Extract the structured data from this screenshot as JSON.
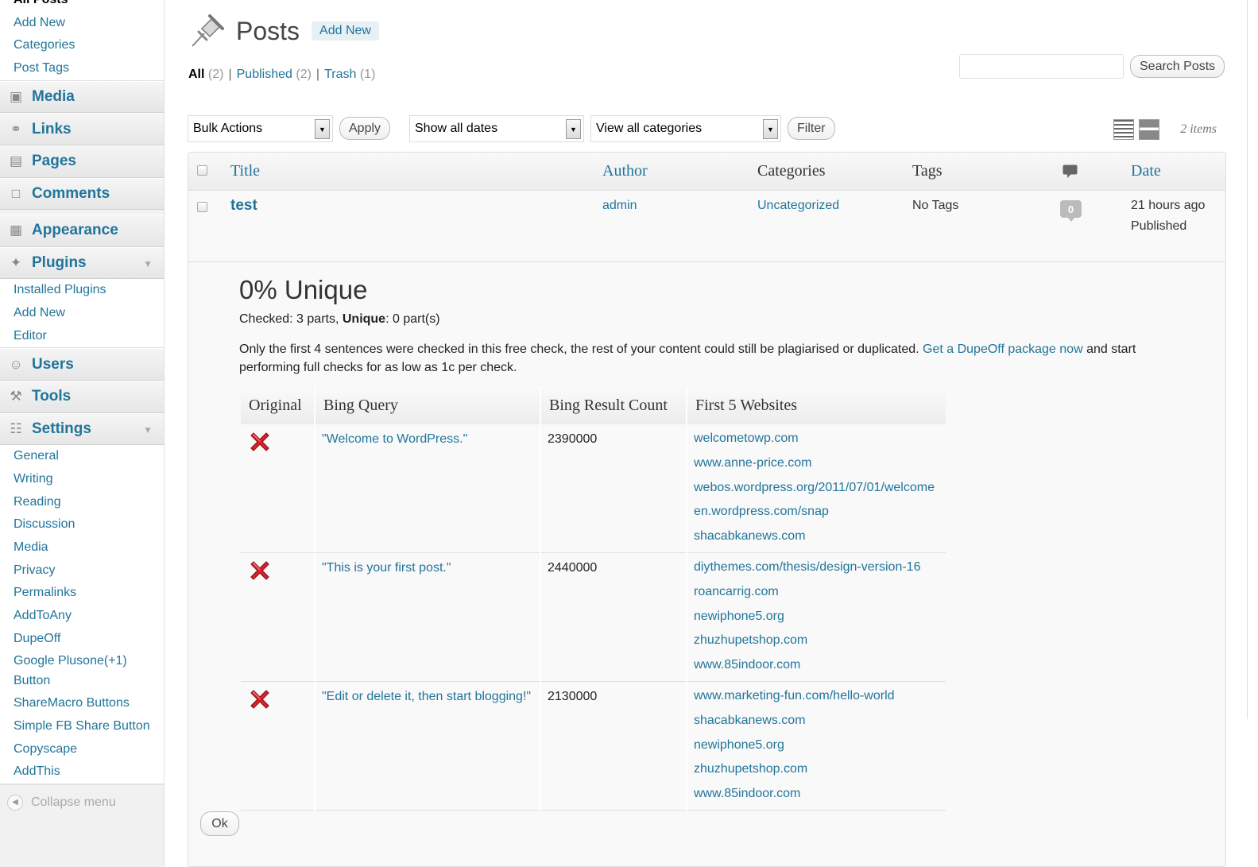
{
  "sidebar": {
    "posts_sub": [
      {
        "label": "All Posts",
        "current": true
      },
      {
        "label": "Add New"
      },
      {
        "label": "Categories"
      },
      {
        "label": "Post Tags"
      }
    ],
    "menu": {
      "media": "Media",
      "links": "Links",
      "pages": "Pages",
      "comments": "Comments",
      "appearance": "Appearance",
      "plugins": "Plugins",
      "users": "Users",
      "tools": "Tools",
      "settings": "Settings"
    },
    "plugins_sub": [
      "Installed Plugins",
      "Add New",
      "Editor"
    ],
    "settings_sub": [
      "General",
      "Writing",
      "Reading",
      "Discussion",
      "Media",
      "Privacy",
      "Permalinks",
      "AddToAny",
      "DupeOff",
      "Google Plusone(+1) Button",
      "ShareMacro Buttons",
      "Simple FB Share Button",
      "Copyscape",
      "AddThis"
    ],
    "collapse": "Collapse menu"
  },
  "header": {
    "title": "Posts",
    "add_new": "Add New"
  },
  "filters": {
    "all": "All",
    "all_count": "(2)",
    "published": "Published",
    "published_count": "(2)",
    "trash": "Trash",
    "trash_count": "(1)"
  },
  "search": {
    "button": "Search Posts",
    "value": ""
  },
  "tablenav": {
    "bulk": "Bulk Actions",
    "apply": "Apply",
    "dates": "Show all dates",
    "categories": "View all categories",
    "filter": "Filter",
    "items": "2 items"
  },
  "columns": {
    "title": "Title",
    "author": "Author",
    "categories": "Categories",
    "tags": "Tags",
    "date": "Date"
  },
  "post": {
    "title": "test",
    "author": "admin",
    "category": "Uncategorized",
    "tags": "No Tags",
    "comments": "0",
    "date": "21 hours ago",
    "status": "Published"
  },
  "dupeoff": {
    "title": "0% Unique",
    "checked_label": "Checked:",
    "checked_value": "3 parts,",
    "unique_label": "Unique",
    "unique_value": ": 0 part(s)",
    "notice": "Only the first 4 sentences were checked in this free check, the rest of your content could still be plagiarised or duplicated.",
    "notice_link": "Get a DupeOff package now",
    "notice_tail": "and start performing full checks for as low as 1c per check.",
    "headers": [
      "Original",
      "Bing Query",
      "Bing Result Count",
      "First 5 Websites"
    ],
    "rows": [
      {
        "query": "\"Welcome to WordPress.\"",
        "count": "2390000",
        "sites": [
          "welcometowp.com",
          "www.anne-price.com",
          "webos.wordpress.org/2011/07/01/welcome",
          "en.wordpress.com/snap",
          "shacabkanews.com"
        ]
      },
      {
        "query": "\"This is your first post.\"",
        "count": "2440000",
        "sites": [
          "diythemes.com/thesis/design-version-16",
          "roancarrig.com",
          "newiphone5.org",
          "zhuzhupetshop.com",
          "www.85indoor.com"
        ]
      },
      {
        "query": "\"Edit or delete it, then start blogging!\"",
        "count": "2130000",
        "sites": [
          "www.marketing-fun.com/hello-world",
          "shacabkanews.com",
          "newiphone5.org",
          "zhuzhupetshop.com",
          "www.85indoor.com"
        ]
      }
    ],
    "ok": "Ok"
  },
  "colors": {
    "link": "#21759b",
    "sidebar_bg": "#f1f1f1",
    "x_red": "#d9232c"
  }
}
